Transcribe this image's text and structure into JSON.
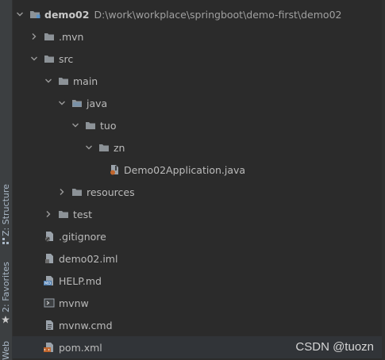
{
  "sidebar": {
    "tabs": [
      {
        "label": "Z: Structure",
        "icon": "structure-icon"
      },
      {
        "label": "2: Favorites",
        "icon": "star-icon"
      },
      {
        "label": "Web",
        "icon": "web-icon"
      }
    ]
  },
  "tree": {
    "root": {
      "name": "demo02",
      "path": "D:\\work\\workplace\\springboot\\demo-first\\demo02"
    },
    "items": [
      {
        "label": ".mvn",
        "icon": "folder-icon"
      },
      {
        "label": "src",
        "icon": "folder-icon"
      },
      {
        "label": "main",
        "icon": "folder-icon"
      },
      {
        "label": "java",
        "icon": "source-folder-icon"
      },
      {
        "label": "tuo",
        "icon": "package-icon"
      },
      {
        "label": "zn",
        "icon": "package-icon"
      },
      {
        "label": "Demo02Application.java",
        "icon": "java-class-icon"
      },
      {
        "label": "resources",
        "icon": "resources-folder-icon"
      },
      {
        "label": "test",
        "icon": "folder-icon"
      },
      {
        "label": ".gitignore",
        "icon": "gitignore-icon"
      },
      {
        "label": "demo02.iml",
        "icon": "iml-file-icon"
      },
      {
        "label": "HELP.md",
        "icon": "markdown-icon"
      },
      {
        "label": "mvnw",
        "icon": "shell-script-icon"
      },
      {
        "label": "mvnw.cmd",
        "icon": "text-file-icon"
      },
      {
        "label": "pom.xml",
        "icon": "maven-pom-icon"
      }
    ]
  },
  "watermark": "CSDN @tuozn",
  "colors": {
    "background": "#2b2b2b",
    "folder": "#8c9297",
    "selection": "#313438"
  }
}
